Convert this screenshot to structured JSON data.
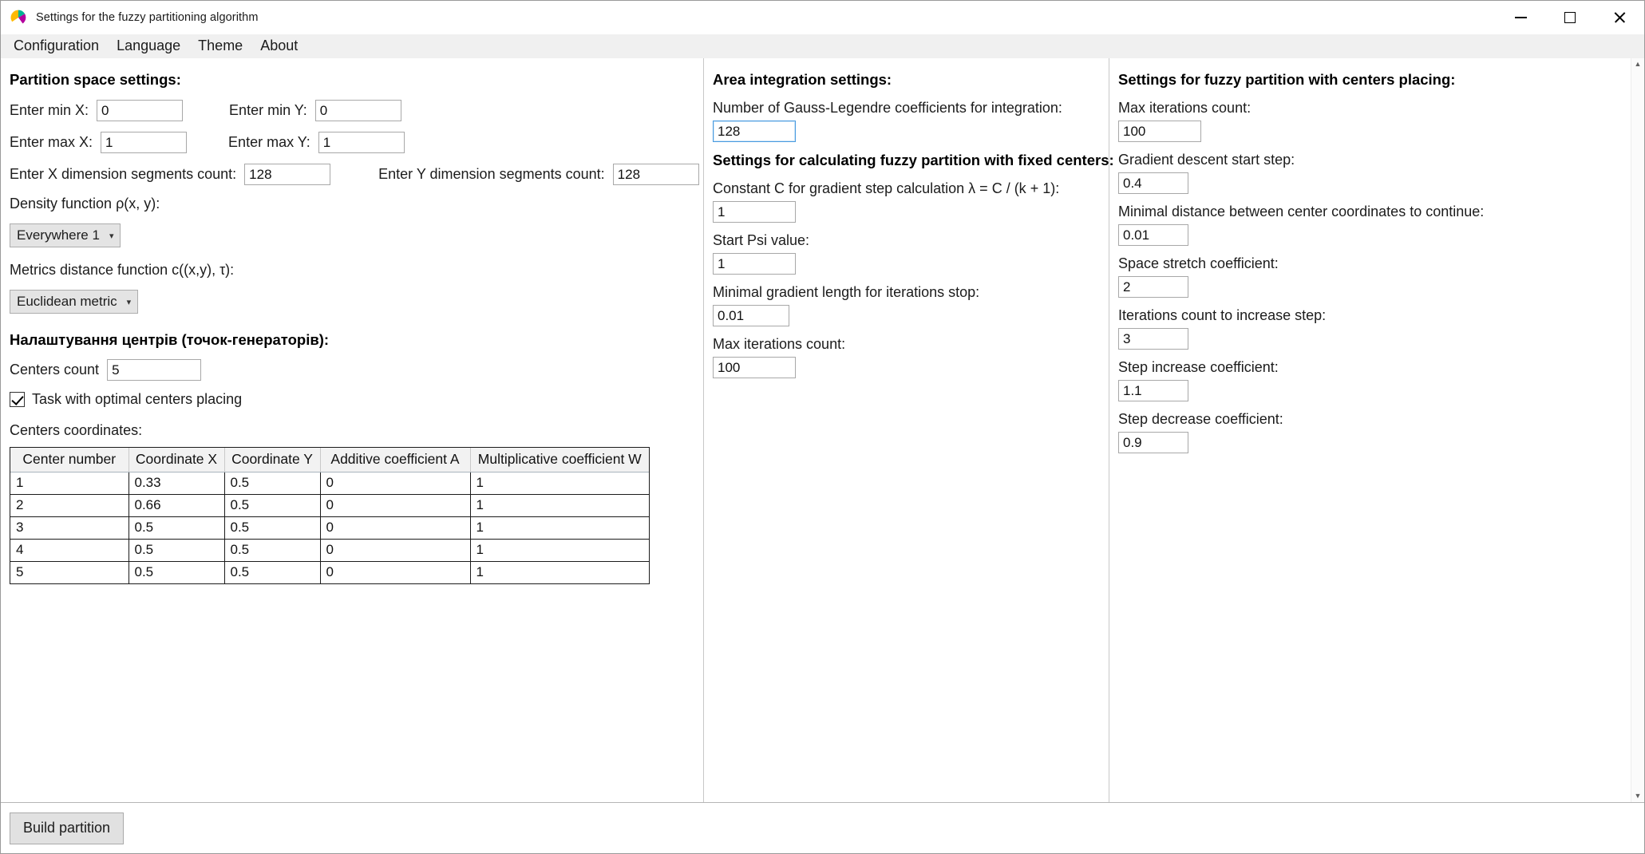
{
  "window": {
    "title": "Settings for the fuzzy partitioning algorithm",
    "icon": "pie-chart-icon",
    "minimize": "minimize-icon",
    "maximize": "maximize-icon",
    "close": "close-icon"
  },
  "menubar": {
    "items": [
      {
        "label": "Configuration"
      },
      {
        "label": "Language"
      },
      {
        "label": "Theme"
      },
      {
        "label": "About"
      }
    ]
  },
  "left": {
    "heading": "Partition space settings:",
    "min_x_label": "Enter min X:",
    "min_x_value": "0",
    "min_y_label": "Enter min Y:",
    "min_y_value": "0",
    "max_x_label": "Enter max X:",
    "max_x_value": "1",
    "max_y_label": "Enter max Y:",
    "max_y_value": "1",
    "seg_x_label": "Enter X dimension segments count:",
    "seg_x_value": "128",
    "seg_y_label": "Enter Y dimension segments count:",
    "seg_y_value": "128",
    "density_label": "Density function ρ(x, y):",
    "density_value": "Everywhere 1",
    "metric_label": "Metrics distance function c((x,y), τ):",
    "metric_value": "Euclidean metric",
    "centers_heading": "Налаштування центрів (точок-генераторів):",
    "centers_count_label": "Centers count",
    "centers_count_value": "5",
    "optimal_checkbox_label": "Task with optimal centers placing",
    "optimal_checkbox_checked": true,
    "centers_coords_label": "Centers coordinates:",
    "table": {
      "columns": [
        "Center number",
        "Coordinate X",
        "Coordinate Y",
        "Additive coefficient A",
        "Multiplicative coefficient W"
      ],
      "rows": [
        [
          "1",
          "0.33",
          "0.5",
          "0",
          "1"
        ],
        [
          "2",
          "0.66",
          "0.5",
          "0",
          "1"
        ],
        [
          "3",
          "0.5",
          "0.5",
          "0",
          "1"
        ],
        [
          "4",
          "0.5",
          "0.5",
          "0",
          "1"
        ],
        [
          "5",
          "0.5",
          "0.5",
          "0",
          "1"
        ]
      ]
    }
  },
  "middle": {
    "heading": "Area integration settings:",
    "gauss_label": "Number of Gauss-Legendre coefficients for integration:",
    "gauss_value": "128",
    "fixed_heading": "Settings for calculating fuzzy partition with fixed centers:",
    "const_c_label": "Constant C for gradient step calculation λ = C / (k + 1):",
    "const_c_value": "1",
    "start_psi_label": "Start Psi value:",
    "start_psi_value": "1",
    "min_grad_label": "Minimal gradient length for iterations stop:",
    "min_grad_value": "0.01",
    "max_iter_label": "Max iterations count:",
    "max_iter_value": "100"
  },
  "right": {
    "heading": "Settings for fuzzy partition with centers placing:",
    "max_iter_label": "Max iterations count:",
    "max_iter_value": "100",
    "grad_start_label": "Gradient descent start step:",
    "grad_start_value": "0.4",
    "min_dist_label": "Minimal distance between center coordinates to continue:",
    "min_dist_value": "0.01",
    "space_stretch_label": "Space stretch coefficient:",
    "space_stretch_value": "2",
    "iter_increase_label": "Iterations count to increase step:",
    "iter_increase_value": "3",
    "step_increase_label": "Step increase coefficient:",
    "step_increase_value": "1.1",
    "step_decrease_label": "Step decrease coefficient:",
    "step_decrease_value": "0.9"
  },
  "footer": {
    "build_label": "Build partition"
  },
  "scrollbar": {
    "up": "▲",
    "down": "▼"
  },
  "colors": {
    "focus_border": "#4a9be0",
    "menubar_bg": "#f0f0f0",
    "button_bg": "#e1e1e1"
  }
}
